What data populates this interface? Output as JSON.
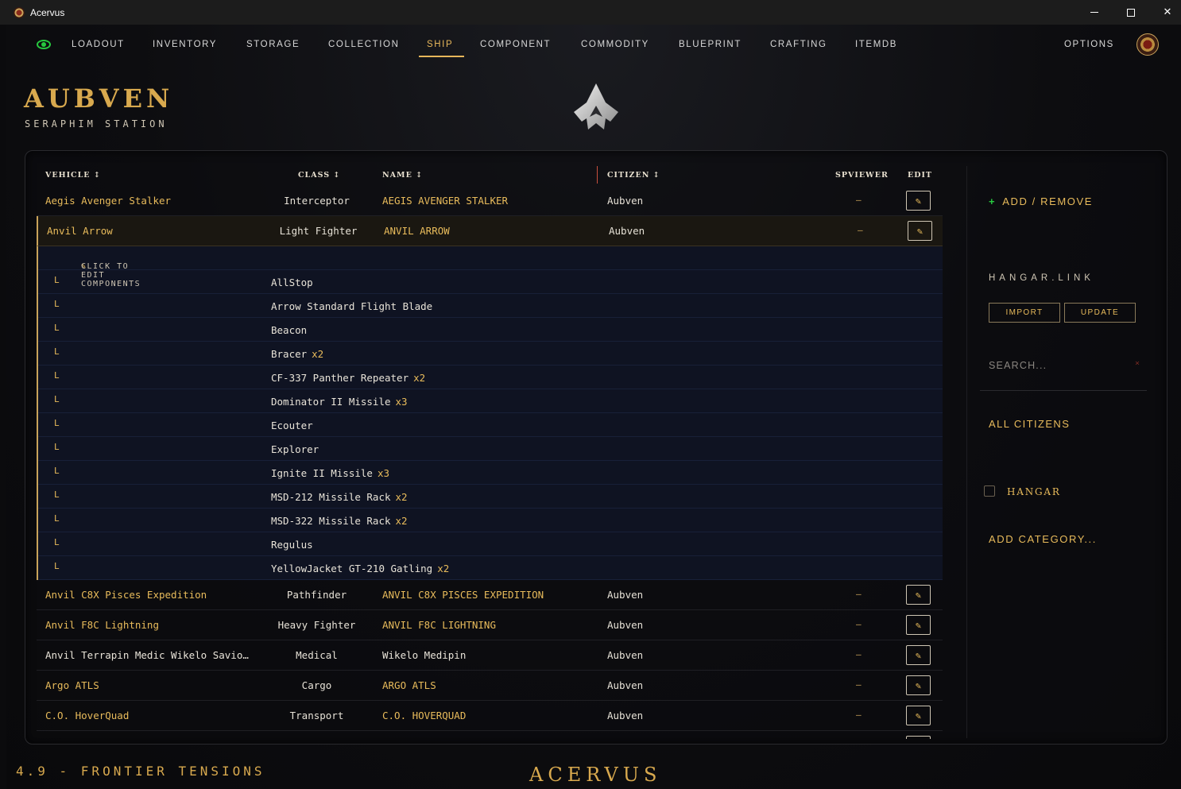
{
  "window": {
    "title": "Acervus"
  },
  "nav": {
    "items": [
      "LOADOUT",
      "INVENTORY",
      "STORAGE",
      "COLLECTION",
      "SHIP",
      "COMPONENT",
      "COMMODITY",
      "BLUEPRINT",
      "CRAFTING",
      "ITEMDB"
    ],
    "active": "SHIP",
    "options_label": "OPTIONS"
  },
  "brand": {
    "name": "AUBVEN",
    "station": "SERAPHIM STATION"
  },
  "table": {
    "headers": {
      "vehicle": "VEHICLE ↕",
      "class": "CLASS ↕",
      "name": "NAME ↕",
      "citizen": "CITIZEN ↕",
      "spviewer": "SPVIEWER",
      "edit": "EDIT"
    },
    "rows": [
      {
        "vehicle": "Aegis Avenger Stalker",
        "class": "Interceptor",
        "name": "AEGIS AVENGER STALKER",
        "citizen": "Aubven",
        "spviewer": "–"
      },
      {
        "vehicle": "Anvil Arrow",
        "class": "Light Fighter",
        "name": "ANVIL ARROW",
        "citizen": "Aubven",
        "spviewer": "–"
      }
    ],
    "expanded": {
      "hint": "CLICK TO EDIT COMPONENTS",
      "components": [
        {
          "name": "AllStop",
          "qty": ""
        },
        {
          "name": "Arrow Standard Flight Blade",
          "qty": ""
        },
        {
          "name": "Beacon",
          "qty": ""
        },
        {
          "name": "Bracer",
          "qty": "x2"
        },
        {
          "name": "CF-337 Panther Repeater",
          "qty": "x2"
        },
        {
          "name": "Dominator II Missile",
          "qty": "x3"
        },
        {
          "name": "Ecouter",
          "qty": ""
        },
        {
          "name": "Explorer",
          "qty": ""
        },
        {
          "name": "Ignite II Missile",
          "qty": "x3"
        },
        {
          "name": "MSD-212 Missile Rack",
          "qty": "x2"
        },
        {
          "name": "MSD-322 Missile Rack",
          "qty": "x2"
        },
        {
          "name": "Regulus",
          "qty": ""
        },
        {
          "name": "YellowJacket GT-210 Gatling",
          "qty": "x2"
        }
      ]
    },
    "rows_after": [
      {
        "vehicle": "Anvil C8X Pisces Expedition",
        "class": "Pathfinder",
        "name": "ANVIL C8X PISCES EXPEDITION",
        "citizen": "Aubven",
        "spviewer": "–"
      },
      {
        "vehicle": "Anvil F8C Lightning",
        "class": "Heavy Fighter",
        "name": "ANVIL F8C LIGHTNING",
        "citizen": "Aubven",
        "spviewer": "–"
      },
      {
        "vehicle": "Anvil Terrapin Medic Wikelo Savio…",
        "class": "Medical",
        "name": "Wikelo Medipin",
        "citizen": "Aubven",
        "spviewer": "–"
      },
      {
        "vehicle": "Argo ATLS",
        "class": "Cargo",
        "name": "ARGO ATLS",
        "citizen": "Aubven",
        "spviewer": "–"
      },
      {
        "vehicle": "C.O. HoverQuad",
        "class": "Transport",
        "name": "C.O. HOVERQUAD",
        "citizen": "Aubven",
        "spviewer": "–"
      }
    ]
  },
  "sidebar": {
    "add_remove": "ADD / REMOVE",
    "hangar_link": "HANGAR.LINK",
    "import": "IMPORT",
    "update": "UPDATE",
    "search_placeholder": "SEARCH...",
    "clear": "×",
    "all_citizens": "ALL CITIZENS",
    "hangar": "HANGAR",
    "add_category": "ADD CATEGORY..."
  },
  "footer": {
    "version": "4.9 - FRONTIER TENSIONS",
    "brand": "ACERVUS"
  },
  "colors": {
    "accent": "#e8bb5b",
    "gold": "#d8a94e",
    "live": "#27c93f"
  }
}
